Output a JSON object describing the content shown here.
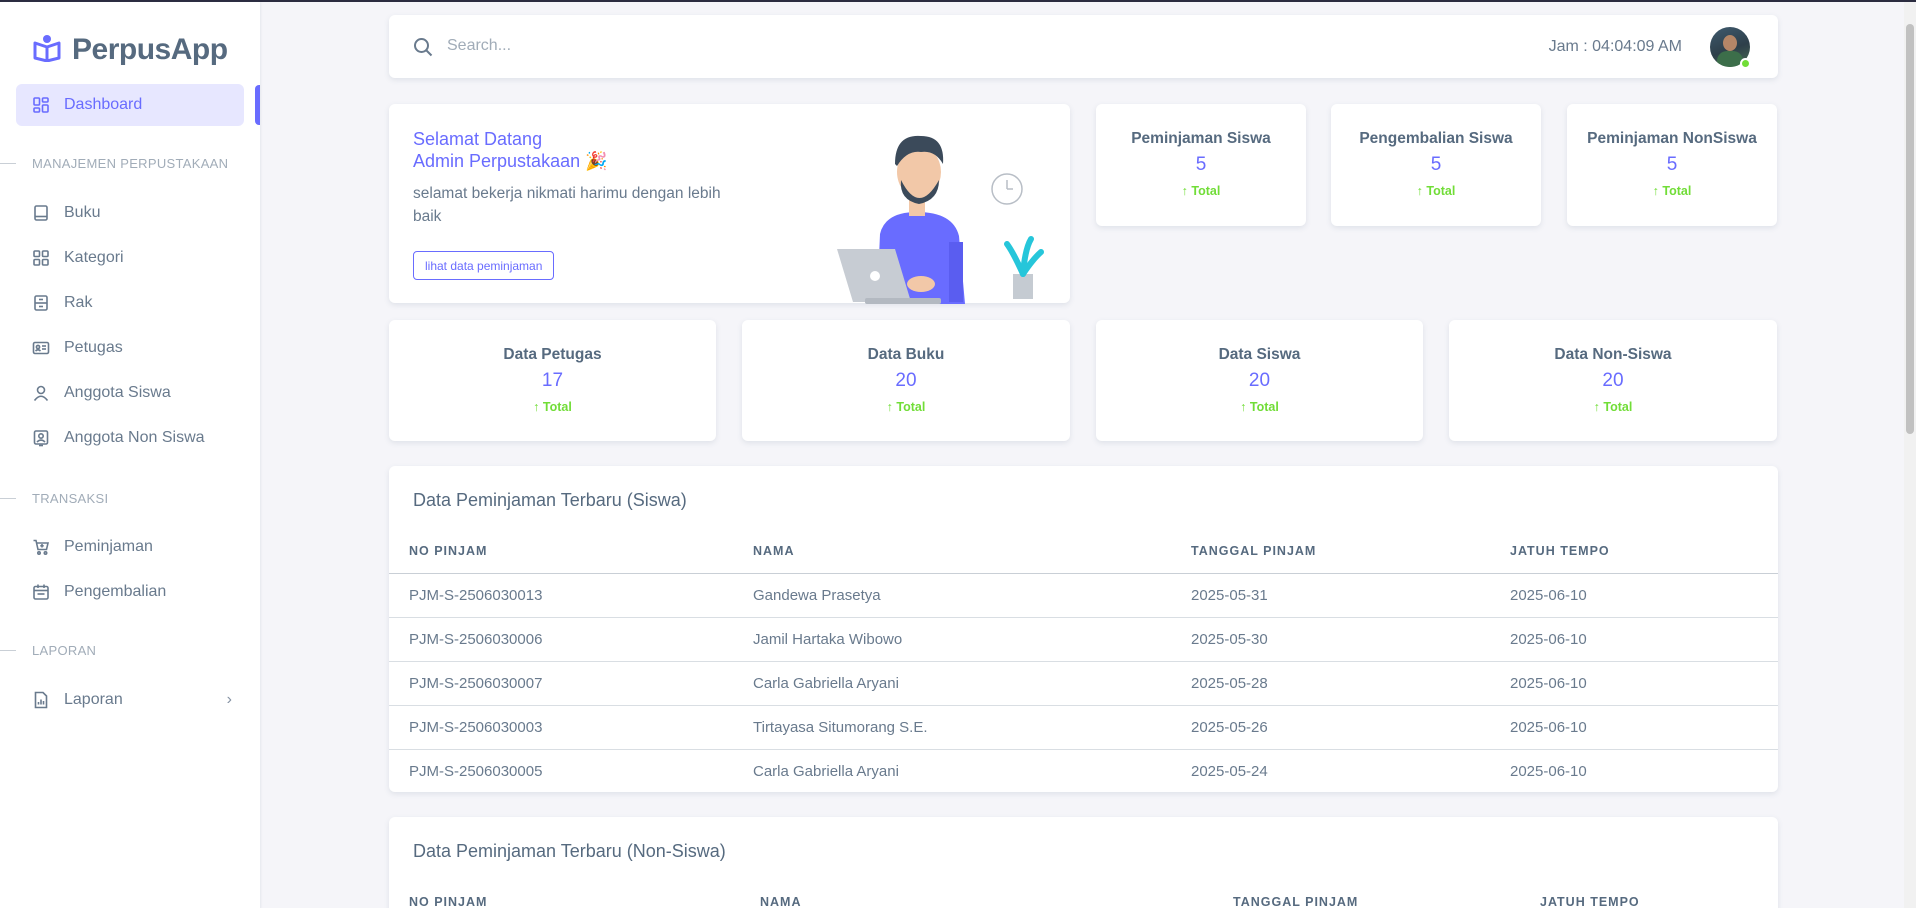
{
  "brand": {
    "name": "PerpusApp"
  },
  "sidebar": {
    "dashboard": "Dashboard",
    "section_manajemen": "MANAJEMEN PERPUSTAKAAN",
    "buku": "Buku",
    "kategori": "Kategori",
    "rak": "Rak",
    "petugas": "Petugas",
    "anggota_siswa": "Anggota Siswa",
    "anggota_non_siswa": "Anggota Non Siswa",
    "section_transaksi": "TRANSAKSI",
    "peminjaman": "Peminjaman",
    "pengembalian": "Pengembalian",
    "section_laporan": "LAPORAN",
    "laporan": "Laporan"
  },
  "navbar": {
    "search_placeholder": "Search...",
    "clock": "Jam : 04:04:09 AM"
  },
  "welcome": {
    "title_line1": "Selamat Datang",
    "title_line2": "Admin Perpustakaan",
    "emoji": "🎉",
    "text": "selamat bekerja nikmati harimu dengan lebih baik",
    "button": "lihat data peminjaman"
  },
  "stats_top": [
    {
      "title": "Peminjaman Siswa",
      "value": "5",
      "sub": "Total"
    },
    {
      "title": "Pengembalian Siswa",
      "value": "5",
      "sub": "Total"
    },
    {
      "title": "Peminjaman NonSiswa",
      "value": "5",
      "sub": "Total"
    }
  ],
  "stats_bottom": [
    {
      "title": "Data Petugas",
      "value": "17",
      "sub": "Total"
    },
    {
      "title": "Data Buku",
      "value": "20",
      "sub": "Total"
    },
    {
      "title": "Data Siswa",
      "value": "20",
      "sub": "Total"
    },
    {
      "title": "Data Non-Siswa",
      "value": "20",
      "sub": "Total"
    }
  ],
  "table_siswa": {
    "title": "Data Peminjaman Terbaru (Siswa)",
    "headers": [
      "NO PINJAM",
      "NAMA",
      "TANGGAL PINJAM",
      "JATUH TEMPO"
    ],
    "rows": [
      [
        "PJM-S-2506030013",
        "Gandewa Prasetya",
        "2025-05-31",
        "2025-06-10"
      ],
      [
        "PJM-S-2506030006",
        "Jamil Hartaka Wibowo",
        "2025-05-30",
        "2025-06-10"
      ],
      [
        "PJM-S-2506030007",
        "Carla Gabriella Aryani",
        "2025-05-28",
        "2025-06-10"
      ],
      [
        "PJM-S-2506030003",
        "Tirtayasa Situmorang S.E.",
        "2025-05-26",
        "2025-06-10"
      ],
      [
        "PJM-S-2506030005",
        "Carla Gabriella Aryani",
        "2025-05-24",
        "2025-06-10"
      ]
    ]
  },
  "table_nonsiswa": {
    "title": "Data Peminjaman Terbaru (Non-Siswa)",
    "headers": [
      "NO PINJAM",
      "NAMA",
      "TANGGAL PINJAM",
      "JATUH TEMPO"
    ]
  },
  "colors": {
    "primary": "#696cff",
    "success": "#71dd37",
    "text": "#697a8d",
    "heading": "#566a7f",
    "background": "#f5f5f9"
  }
}
